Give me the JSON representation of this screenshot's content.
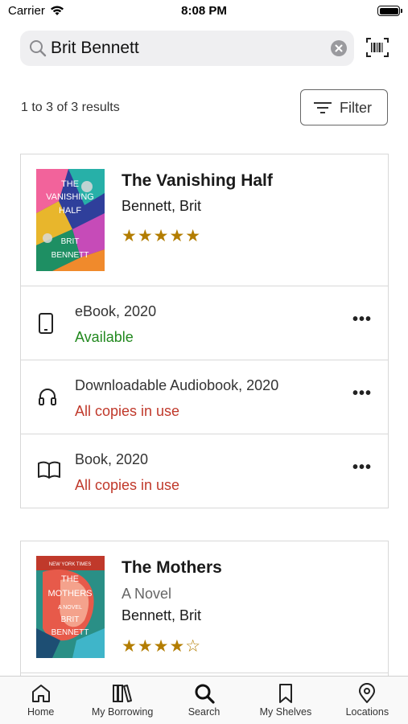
{
  "status_bar": {
    "carrier": "Carrier",
    "time": "8:08 PM"
  },
  "search": {
    "value": "Brit Bennett"
  },
  "results": {
    "count_text": "1 to 3 of 3 results",
    "filter_label": "Filter"
  },
  "books": [
    {
      "title": "The Vanishing Half",
      "subtitle": "",
      "author": "Bennett, Brit",
      "rating": 5,
      "rating_stars": "★★★★★",
      "formats": [
        {
          "name": "eBook, 2020",
          "status": "Available",
          "icon": "tablet-icon"
        },
        {
          "name": "Downloadable Audiobook, 2020",
          "status": "All copies in use",
          "icon": "headphones-icon"
        },
        {
          "name": "Book, 2020",
          "status": "All copies in use",
          "icon": "book-icon"
        }
      ]
    },
    {
      "title": "The Mothers",
      "subtitle": "A Novel",
      "author": "Bennett, Brit",
      "rating": 4,
      "rating_stars": "★★★★☆"
    }
  ],
  "colors": {
    "available": "#22891f",
    "unavailable": "#c0392b",
    "stars": "#b37d00"
  },
  "tabs": [
    {
      "label": "Home",
      "icon": "home-icon"
    },
    {
      "label": "My Borrowing",
      "icon": "books-icon"
    },
    {
      "label": "Search",
      "icon": "search-icon"
    },
    {
      "label": "My Shelves",
      "icon": "bookmark-icon"
    },
    {
      "label": "Locations",
      "icon": "location-pin-icon"
    }
  ]
}
